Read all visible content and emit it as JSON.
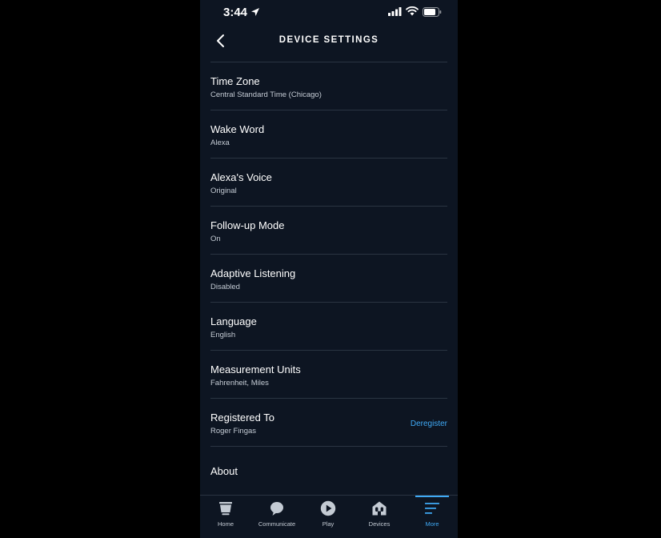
{
  "status_bar": {
    "time": "3:44"
  },
  "header": {
    "title": "DEVICE SETTINGS"
  },
  "settings": [
    {
      "title": "Time Zone",
      "value": "Central Standard Time (Chicago)"
    },
    {
      "title": "Wake Word",
      "value": "Alexa"
    },
    {
      "title": "Alexa's Voice",
      "value": "Original"
    },
    {
      "title": "Follow-up Mode",
      "value": "On"
    },
    {
      "title": "Adaptive Listening",
      "value": "Disabled"
    },
    {
      "title": "Language",
      "value": "English"
    },
    {
      "title": "Measurement Units",
      "value": "Fahrenheit, Miles"
    },
    {
      "title": "Registered To",
      "value": "Roger Fingas",
      "action": "Deregister"
    }
  ],
  "about": {
    "title": "About"
  },
  "tabs": [
    {
      "label": "Home",
      "icon": "home-icon"
    },
    {
      "label": "Communicate",
      "icon": "chat-bubble-icon"
    },
    {
      "label": "Play",
      "icon": "play-icon"
    },
    {
      "label": "Devices",
      "icon": "devices-icon"
    },
    {
      "label": "More",
      "icon": "menu-icon",
      "active": true
    }
  ],
  "colors": {
    "background": "#0d1522",
    "accent": "#3fa9f5",
    "divider": "#2a3442"
  }
}
